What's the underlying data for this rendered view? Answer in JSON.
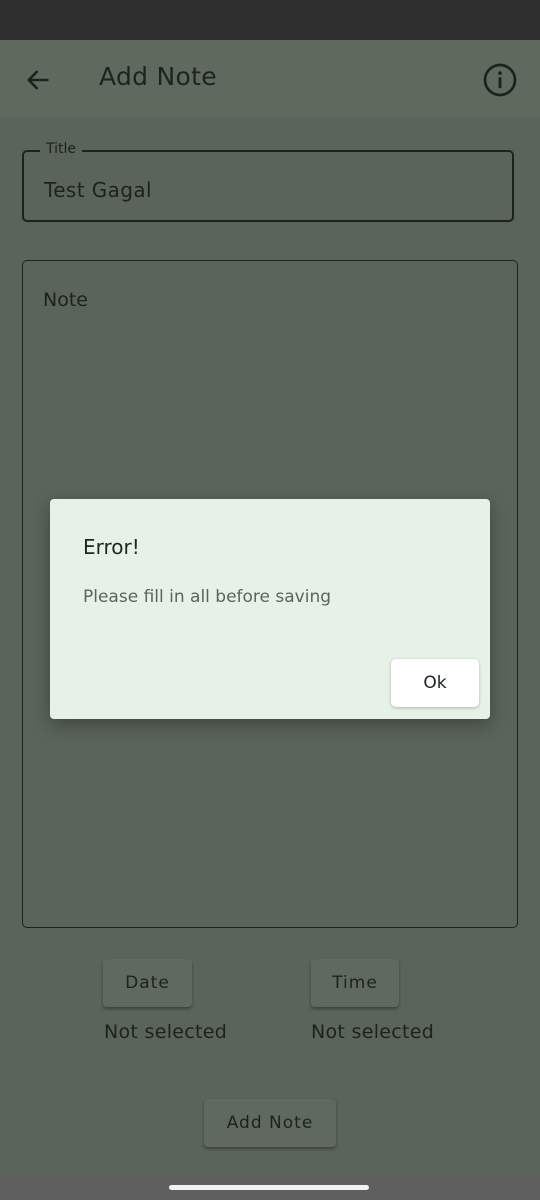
{
  "colors": {
    "status_bar": "#2f2f2f",
    "app_bar": "#5f6a5f",
    "background_dimmed": "#5a645a",
    "dialog_background": "#e6f2e8",
    "text_dark": "#1c221c"
  },
  "app_bar": {
    "title": "Add Note",
    "back_icon": "arrow-left-icon",
    "info_icon": "info-circle-icon"
  },
  "form": {
    "title_label": "Title",
    "title_value": "Test Gagal",
    "note_placeholder": "Note",
    "date_button": "Date",
    "time_button": "Time",
    "date_value": "Not selected",
    "time_value": "Not selected",
    "add_button": "Add Note"
  },
  "dialog": {
    "title": "Error!",
    "message": "Please fill in all before saving",
    "ok_button": "Ok"
  }
}
